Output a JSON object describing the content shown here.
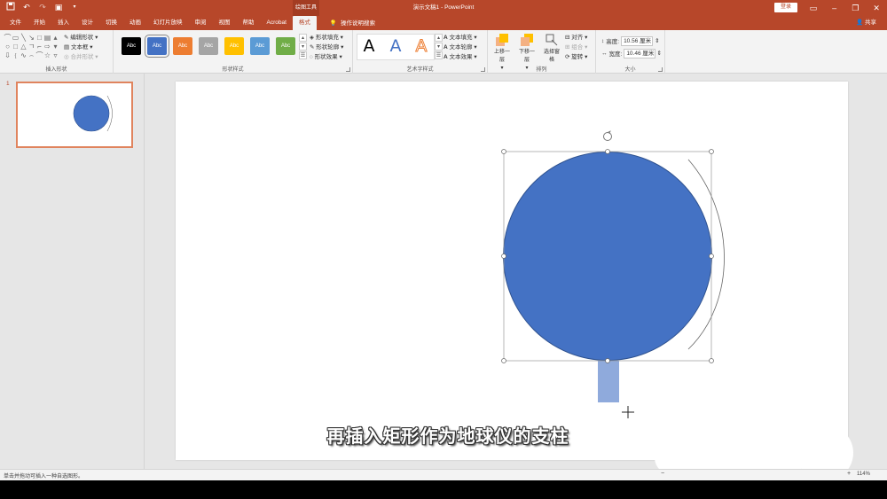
{
  "app": {
    "doc_title": "演示文稿1  -  PowerPoint",
    "contextual_tab_label": "绘图工具",
    "login_label": "登录",
    "share_label": "共享"
  },
  "quick_access": {
    "save_icon": "save-icon",
    "undo_icon": "undo-icon",
    "redo_icon": "redo-icon",
    "present_icon": "start-from-beginning-icon",
    "customize_icon": "customize-qat-icon"
  },
  "tabs": [
    {
      "label": "文件"
    },
    {
      "label": "开始"
    },
    {
      "label": "插入"
    },
    {
      "label": "设计"
    },
    {
      "label": "切换"
    },
    {
      "label": "动画"
    },
    {
      "label": "幻灯片放映"
    },
    {
      "label": "审阅"
    },
    {
      "label": "视图"
    },
    {
      "label": "帮助"
    },
    {
      "label": "Acrobat"
    },
    {
      "label": "格式",
      "active": true
    }
  ],
  "tell_me": {
    "label": "操作说明搜索"
  },
  "ribbon": {
    "insert_shapes": {
      "label": "插入形状",
      "edit_shape": "编辑形状",
      "text_box": "文本框",
      "merge_shapes": "合并形状"
    },
    "shape_styles": {
      "label": "形状样式",
      "swatches": [
        {
          "text": "Abc",
          "color": "#000000"
        },
        {
          "text": "Abc",
          "color": "#4472c4"
        },
        {
          "text": "Abc",
          "color": "#ed7d31"
        },
        {
          "text": "Abc",
          "color": "#a5a5a5"
        },
        {
          "text": "Abc",
          "color": "#ffc000"
        },
        {
          "text": "Abc",
          "color": "#5b9bd5"
        },
        {
          "text": "Abc",
          "color": "#70ad47"
        }
      ],
      "fill": "形状填充",
      "outline": "形状轮廓",
      "effects": "形状效果"
    },
    "wordart": {
      "label": "艺术字样式",
      "samples": [
        "A",
        "A",
        "A"
      ],
      "text_fill": "文本填充",
      "text_outline": "文本轮廓",
      "text_effects": "文本效果"
    },
    "arrange": {
      "label": "排列",
      "bring_forward": "上移一层",
      "send_backward": "下移一层",
      "selection_pane": "选择窗格",
      "align": "对齐",
      "group": "组合",
      "rotate": "旋转"
    },
    "size": {
      "label": "大小",
      "height_label": "高度:",
      "height_value": "10.56 厘米",
      "width_label": "宽度:",
      "width_value": "10.46 厘米"
    }
  },
  "slide_panel": {
    "slide_number": "1"
  },
  "slide": {
    "caption": "再插入矩形作为地球仪的支柱",
    "circle_color": "#4472c4",
    "rect_color": "#8faadc"
  },
  "statusbar": {
    "status_text": "单击并拖动可插入一种自选图形。",
    "zoom_level": "114%"
  }
}
